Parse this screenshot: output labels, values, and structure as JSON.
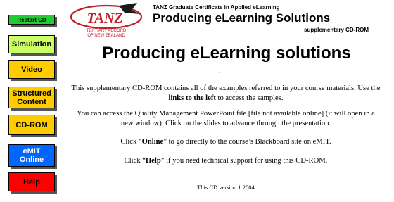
{
  "nav": {
    "restart": {
      "label": "Restart CD",
      "color": "#22cc33"
    },
    "simulation": {
      "label": "Simulation",
      "color": "#ccff66"
    },
    "video": {
      "label": "Video",
      "color": "#ffcc00"
    },
    "structured": {
      "line1": "Structured",
      "line2": "Content",
      "color": "#ffcc00"
    },
    "cdrom": {
      "label": "CD-ROM",
      "color": "#ffcc00"
    },
    "emit": {
      "line1": "eMIT",
      "line2": "Online",
      "color": "#0066ff"
    },
    "help": {
      "label": "Help",
      "color": "#ff0000"
    }
  },
  "header": {
    "logo_text": "TANZ",
    "logo_sub1": "TERTIARY ACCORD",
    "logo_sub2": "OF NEW ZEALAND",
    "certificate": "TANZ Graduate Certificate in Applied eLearning",
    "title": "Producing eLearning Solutions",
    "subtitle": "supplementary CD-ROM"
  },
  "main": {
    "title": "Producing eLearning solutions",
    "dot": ".",
    "p1_a": "This supplementary CD-ROM contains all of the examples referred to in your course materials. Use the ",
    "p1_b": "links to the left",
    "p1_c": " to access the samples.",
    "p2": "You can access the Quality Management PowerPoint file [file not available online] (it will open in a new window). Click on the slides to advance through the presentation.",
    "p3_a": "Click “",
    "p3_b": "Online",
    "p3_c": "” to go directly to the course’s Blackboard site on eMIT.",
    "p4_a": "Click “",
    "p4_b": "Help",
    "p4_c": "” if you need technical support for using this CD-ROM.",
    "footer": "This CD version 1 2004."
  }
}
